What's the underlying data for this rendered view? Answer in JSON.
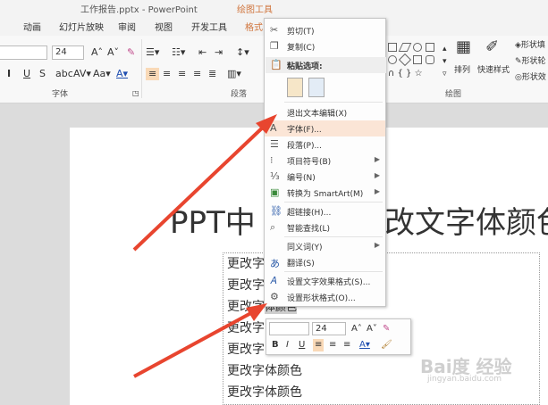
{
  "window": {
    "title": "工作报告.pptx - PowerPoint",
    "context_tab": "绘图工具"
  },
  "tabs": [
    {
      "label": "动画"
    },
    {
      "label": "幻灯片放映"
    },
    {
      "label": "审阅"
    },
    {
      "label": "视图"
    },
    {
      "label": "开发工具"
    },
    {
      "label": "格式"
    }
  ],
  "ribbon": {
    "font_size": "24",
    "font_group_label": "字体",
    "paragraph_group_label": "段落",
    "drawing_group_label": "绘图",
    "arrange_label": "排列",
    "quick_styles_label": "快速样式",
    "shape_fill": "形状填",
    "shape_outline": "形状轮",
    "shape_effect": "形状效"
  },
  "slide": {
    "title_left": "PPT中",
    "title_right": "改文字体颜色",
    "lines": [
      "更改字",
      "更改字",
      "更改字",
      "更改字",
      "更改字",
      "更改字体颜色",
      "更改字体颜色"
    ],
    "highlight_text": "体颜色"
  },
  "context_menu": {
    "items": [
      {
        "label": "剪切(T)",
        "icon": "scissors-icon"
      },
      {
        "label": "复制(C)",
        "icon": "copy-icon"
      },
      {
        "label": "粘贴选项:",
        "icon": "paste-icon"
      },
      {
        "label": "退出文本编辑(X)",
        "icon": ""
      },
      {
        "label": "字体(F)...",
        "icon": "font-icon"
      },
      {
        "label": "段落(P)...",
        "icon": "paragraph-icon"
      },
      {
        "label": "项目符号(B)",
        "icon": "bullets-icon",
        "submenu": true
      },
      {
        "label": "编号(N)",
        "icon": "numbering-icon",
        "submenu": true
      },
      {
        "label": "转换为 SmartArt(M)",
        "icon": "smartart-icon",
        "submenu": true
      },
      {
        "label": "超链接(H)...",
        "icon": "link-icon"
      },
      {
        "label": "智能查找(L)",
        "icon": "search-icon"
      },
      {
        "label": "同义词(Y)",
        "icon": "",
        "submenu": true
      },
      {
        "label": "翻译(S)",
        "icon": "translate-icon"
      },
      {
        "label": "设置文字效果格式(S)...",
        "icon": "text-effect-icon"
      },
      {
        "label": "设置形状格式(O)...",
        "icon": "shape-format-icon"
      }
    ]
  },
  "mini_toolbar": {
    "font_size": "24"
  },
  "watermark": {
    "text": "Bai度 经验",
    "url": "jingyan.baidu.com"
  },
  "colors": {
    "accent": "#d0743c",
    "arrow": "#e8452f",
    "hover": "#fbe5d6"
  }
}
